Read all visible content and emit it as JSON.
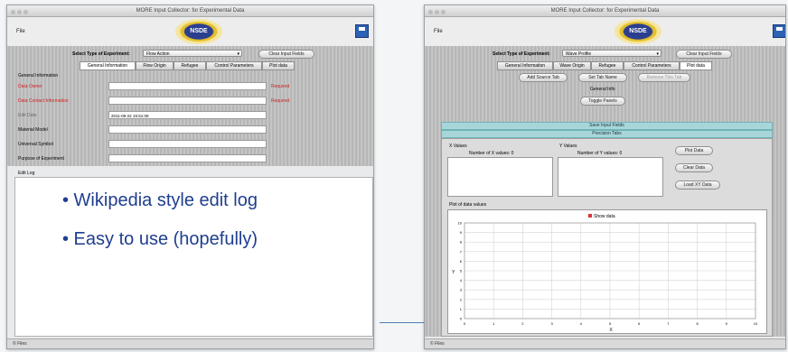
{
  "left_window": {
    "title": "MORE Input Collector: for Experimental Data",
    "menu_file": "File",
    "logo_text": "NSDE",
    "experiment_type_label": "Select Type of Experiment:",
    "experiment_type_value": "Flow Action",
    "clear_button": "Clear Input Fields",
    "tabs": [
      "General Information",
      "Flow Origin",
      "Refugee",
      "Control Parameters",
      "Plot data"
    ],
    "active_tab": 0,
    "section_header": "General Information",
    "fields": [
      {
        "label": "Data Owner",
        "value": "",
        "required": true,
        "flag": "Required"
      },
      {
        "label": "Data Contact Information",
        "value": "",
        "required": true,
        "flag": "Required"
      },
      {
        "label": "Edit Date",
        "value": "2011-09-22 15:51:08",
        "required": false,
        "flag": ""
      },
      {
        "label": "Material Model",
        "value": "",
        "required": false,
        "flag": ""
      },
      {
        "label": "Universal Symbol",
        "value": "",
        "required": false,
        "flag": ""
      },
      {
        "label": "Purpose of Experiment",
        "value": "",
        "required": false,
        "flag": ""
      }
    ],
    "edit_log_label": "Edit Log",
    "bullets": [
      "• Wikipedia style edit log",
      "• Easy to use (hopefully)"
    ],
    "status": "© Files"
  },
  "right_window": {
    "title": "MORE Input Collector: for Experimental Data",
    "menu_file": "File",
    "logo_text": "NSDE",
    "experiment_type_label": "Select Type of Experiment:",
    "experiment_type_value": "Wave Profile",
    "clear_button": "Clear Input Fields",
    "tabs": [
      "General Information",
      "Wave Origin",
      "Refugee",
      "Control Parameters",
      "Plot data"
    ],
    "active_tab": 4,
    "tab_buttons": [
      "Add Source Tab",
      "Set Tab Name",
      "Remove This Tab"
    ],
    "sub_label": "General Info",
    "toggle_button": "Toggle Panels",
    "cyan_rows": [
      "Save Input Fields",
      "Precision Tabs"
    ],
    "x_values_label": "X Values",
    "y_values_label": "Y Values",
    "num_x_label": "Number of X values: 0",
    "num_y_label": "Number of Y values: 0",
    "side_buttons": [
      "Plot Data",
      "Clear Data",
      "Load XY Data"
    ],
    "plot_label": "Plot of data values",
    "plot_checkbox": "Show data",
    "y_ticks": [
      "10",
      "9",
      "8",
      "7",
      "6",
      "5",
      "4",
      "3",
      "2",
      "1",
      "0"
    ],
    "x_ticks": [
      "0",
      "1",
      "2",
      "3",
      "4",
      "5",
      "6",
      "7",
      "8",
      "9",
      "10"
    ],
    "x_axis_title": "X",
    "y_axis_title": "Y",
    "status": "© Files"
  }
}
